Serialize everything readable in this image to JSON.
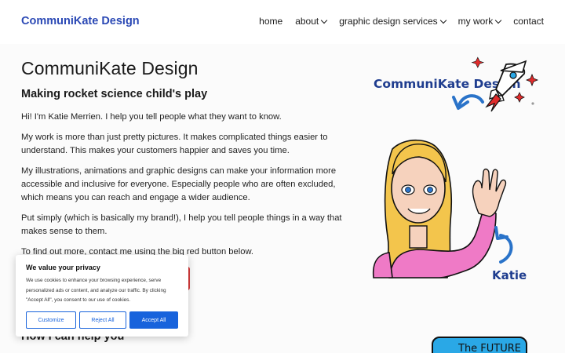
{
  "header": {
    "site_title": "CommuniKate Design",
    "nav": [
      {
        "label": "home",
        "dropdown": false
      },
      {
        "label": "about",
        "dropdown": true
      },
      {
        "label": "graphic design services",
        "dropdown": true
      },
      {
        "label": "my work",
        "dropdown": true
      },
      {
        "label": "contact",
        "dropdown": false
      }
    ]
  },
  "main": {
    "title": "CommuniKate Design",
    "tagline": "Making rocket science child's play",
    "paragraphs": [
      "Hi! I'm Katie Merrien. I help you tell people what they want to know.",
      "My work is more than just pretty pictures. It makes complicated things easier to understand. This makes your customers happier and saves you time.",
      "My illustrations, animations and graphic designs can make your information more accessible and inclusive for everyone. Especially people who are often excluded, which means you can reach and engage a wider audience.",
      "Put simply (which is basically my brand!), I help you tell people things in a way that makes sense to them.",
      "To find out more, contact me using the big red button below."
    ],
    "section_heading": "How I can help you"
  },
  "illustration": {
    "logo_text": "CommuniKate Design",
    "name_label": "Katie",
    "future_text": "The FUTURE"
  },
  "cookie_banner": {
    "title": "We value your privacy",
    "message": "We use cookies to enhance your browsing experience, serve personalized ads or content, and analyze our traffic. By clicking \"Accept All\", you consent to our use of cookies.",
    "customize_label": "Customize",
    "reject_label": "Reject All",
    "accept_label": "Accept All"
  },
  "colors": {
    "brand_blue": "#2b49b5",
    "cookie_blue": "#1863dc",
    "cta_red": "#d83b3b"
  }
}
